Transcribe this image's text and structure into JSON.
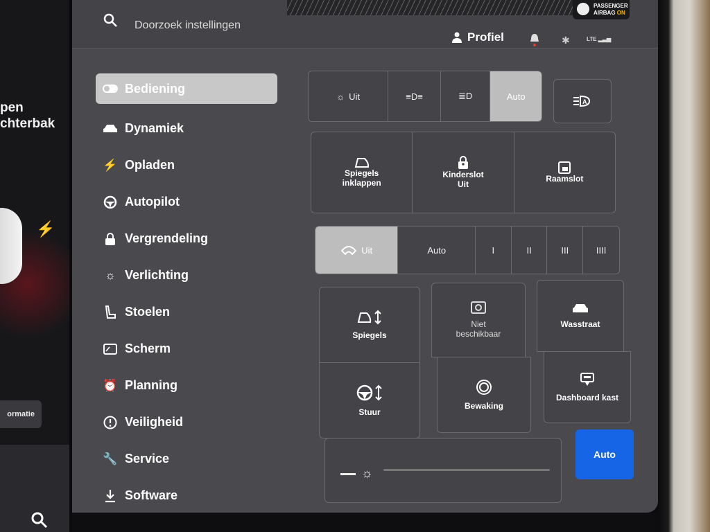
{
  "left_panel": {
    "line1": "pen",
    "line2": "chterbak",
    "info_button": "ormatie"
  },
  "topbar": {
    "search_placeholder": "Doorzoek instellingen",
    "profile_label": "Profiel",
    "network": "LTE",
    "airbag_line1": "PASSENGER",
    "airbag_line2": "AIRBAG",
    "airbag_status": "ON"
  },
  "nav": {
    "items": [
      {
        "label": "Bediening",
        "icon": "toggle-icon",
        "active": true
      },
      {
        "label": "Dynamiek",
        "icon": "car-icon"
      },
      {
        "label": "Opladen",
        "icon": "bolt-icon"
      },
      {
        "label": "Autopilot",
        "icon": "steering-wheel-icon"
      },
      {
        "label": "Vergrendeling",
        "icon": "lock-icon"
      },
      {
        "label": "Verlichting",
        "icon": "sun-icon"
      },
      {
        "label": "Stoelen",
        "icon": "seat-icon"
      },
      {
        "label": "Scherm",
        "icon": "display-icon"
      },
      {
        "label": "Planning",
        "icon": "alarm-clock-icon"
      },
      {
        "label": "Veiligheid",
        "icon": "alert-circle-icon"
      },
      {
        "label": "Service",
        "icon": "wrench-icon"
      },
      {
        "label": "Software",
        "icon": "download-icon"
      }
    ]
  },
  "lights": {
    "off_label": "Uit",
    "auto_label": "Auto",
    "selected": "Auto"
  },
  "quick_cards": {
    "mirrors_fold_line1": "Spiegels",
    "mirrors_fold_line2": "inklappen",
    "child_lock_label": "Kinderslot",
    "child_lock_status": "Uit",
    "window_lock_label": "Raamslot"
  },
  "wipers": {
    "off_label": "Uit",
    "auto_label": "Auto",
    "speeds": [
      "I",
      "II",
      "III",
      "IIII"
    ],
    "selected": "Uit"
  },
  "adjust": {
    "mirrors_label": "Spiegels",
    "steering_label": "Stuur",
    "dashcam_line1": "Niet",
    "dashcam_line2": "beschikbaar",
    "sentry_label": "Bewaking",
    "carwash_label": "Wasstraat",
    "glovebox_label": "Dashboard kast"
  },
  "brightness": {
    "auto_label": "Auto",
    "level": 0.08
  },
  "colors": {
    "accent": "#1565e6",
    "panel": "#4a4a4e",
    "selected": "#bdbdbd"
  }
}
